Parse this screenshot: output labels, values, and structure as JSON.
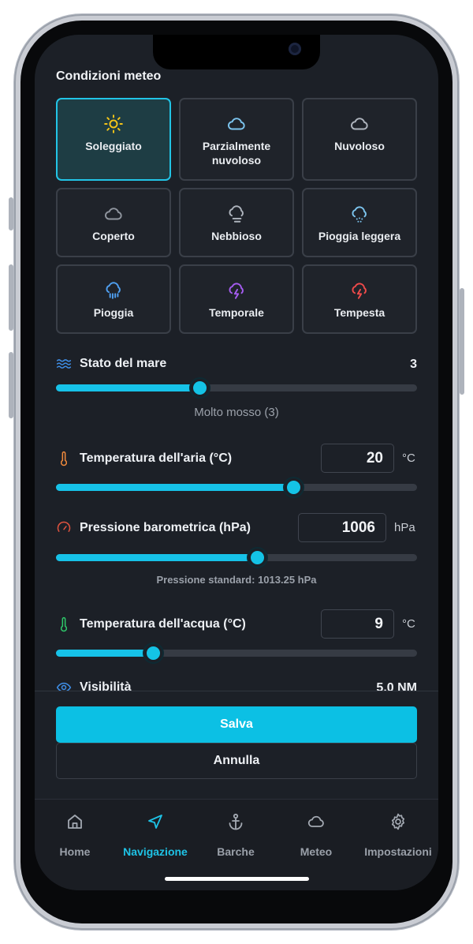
{
  "weather": {
    "title": "Condizioni meteo",
    "options": [
      {
        "label": "Soleggiato",
        "icon": "sun-icon",
        "selected": true
      },
      {
        "label": "Parzialmente nuvoloso",
        "icon": "cloud-icon"
      },
      {
        "label": "Nuvoloso",
        "icon": "cloud-icon"
      },
      {
        "label": "Coperto",
        "icon": "cloud-icon"
      },
      {
        "label": "Nebbioso",
        "icon": "fog-icon"
      },
      {
        "label": "Pioggia leggera",
        "icon": "light-rain-icon"
      },
      {
        "label": "Pioggia",
        "icon": "rain-icon"
      },
      {
        "label": "Temporale",
        "icon": "thunderstorm-icon"
      },
      {
        "label": "Tempesta",
        "icon": "storm-icon"
      }
    ]
  },
  "sea_state": {
    "label": "Stato del mare",
    "value": "3",
    "description": "Molto mosso (3)",
    "level": 0.4
  },
  "air_temp": {
    "label": "Temperatura dell'aria (°C)",
    "value": "20",
    "unit": "°C",
    "level": 0.66
  },
  "pressure": {
    "label": "Pressione barometrica (hPa)",
    "value": "1006",
    "unit": "hPa",
    "hint": "Pressione standard: 1013.25 hPa",
    "level": 0.56
  },
  "water_temp": {
    "label": "Temperatura dell'acqua (°C)",
    "value": "9",
    "unit": "°C",
    "level": 0.27
  },
  "visibility": {
    "label": "Visibilità",
    "value": "5.0 NM"
  },
  "actions": {
    "save": "Salva",
    "cancel": "Annulla"
  },
  "tabs": [
    {
      "label": "Home",
      "icon": "home-icon"
    },
    {
      "label": "Navigazione",
      "icon": "navigation-icon",
      "active": true
    },
    {
      "label": "Barche",
      "icon": "anchor-icon"
    },
    {
      "label": "Meteo",
      "icon": "cloud-icon"
    },
    {
      "label": "Impostazioni",
      "icon": "gear-icon"
    }
  ],
  "colors": {
    "accent": "#16c2e8",
    "background": "#1c2027"
  }
}
